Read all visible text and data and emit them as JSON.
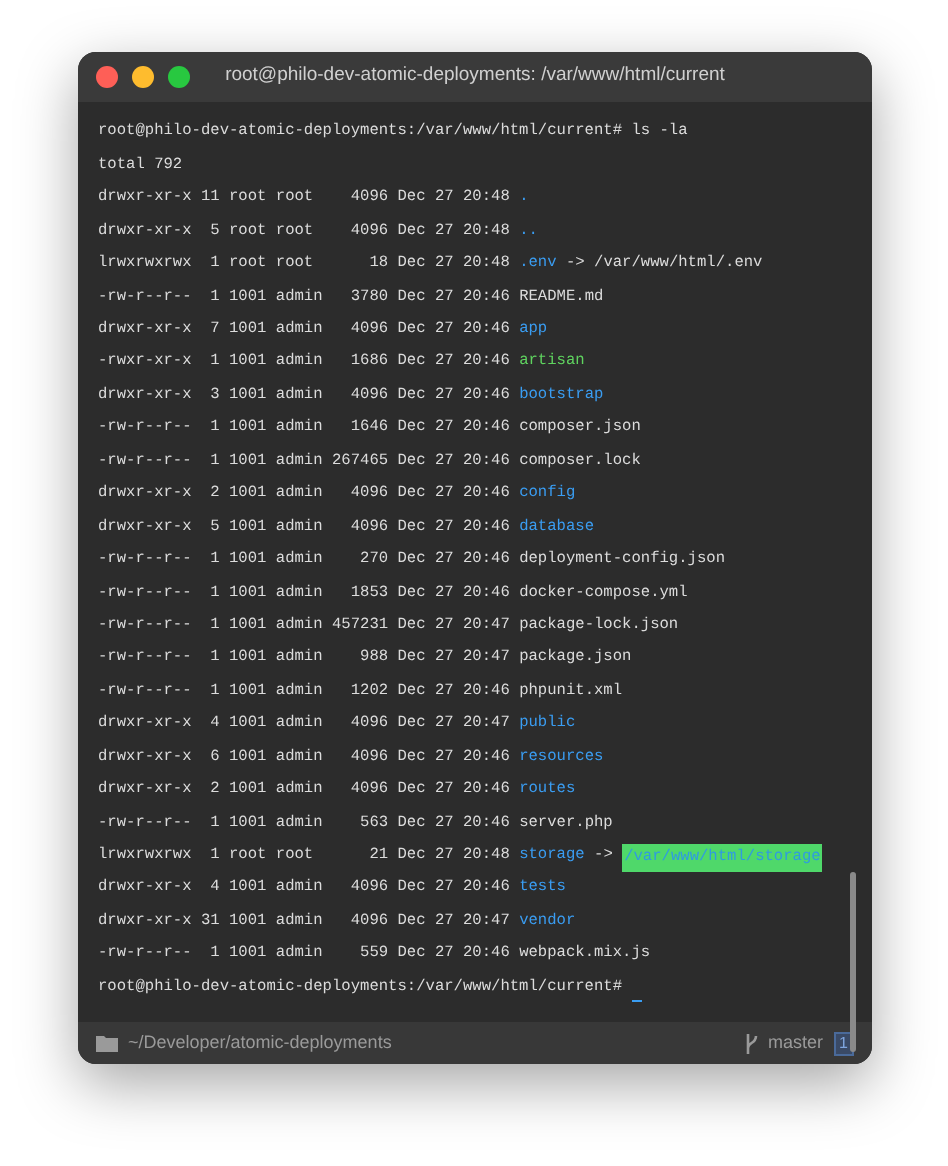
{
  "window": {
    "title": "root@philo-dev-atomic-deployments: /var/www/html/current"
  },
  "terminal": {
    "command_line": "root@philo-dev-atomic-deployments:/var/www/html/current# ls -la",
    "total": "total 792",
    "entries": [
      {
        "info": "drwxr-xr-x 11 root root    4096 Dec 27 20:48",
        "name": ".",
        "kind": "dir"
      },
      {
        "info": "drwxr-xr-x  5 root root    4096 Dec 27 20:48",
        "name": "..",
        "kind": "dir"
      },
      {
        "info": "lrwxrwxrwx  1 root root      18 Dec 27 20:48",
        "name": ".env",
        "kind": "link",
        "arrow": "->",
        "target": "/var/www/html/.env",
        "target_highlighted": false
      },
      {
        "info": "-rw-r--r--  1 1001 admin   3780 Dec 27 20:46",
        "name": "README.md",
        "kind": "file"
      },
      {
        "info": "drwxr-xr-x  7 1001 admin   4096 Dec 27 20:46",
        "name": "app",
        "kind": "dir"
      },
      {
        "info": "-rwxr-xr-x  1 1001 admin   1686 Dec 27 20:46",
        "name": "artisan",
        "kind": "exec"
      },
      {
        "info": "drwxr-xr-x  3 1001 admin   4096 Dec 27 20:46",
        "name": "bootstrap",
        "kind": "dir"
      },
      {
        "info": "-rw-r--r--  1 1001 admin   1646 Dec 27 20:46",
        "name": "composer.json",
        "kind": "file"
      },
      {
        "info": "-rw-r--r--  1 1001 admin 267465 Dec 27 20:46",
        "name": "composer.lock",
        "kind": "file"
      },
      {
        "info": "drwxr-xr-x  2 1001 admin   4096 Dec 27 20:46",
        "name": "config",
        "kind": "dir"
      },
      {
        "info": "drwxr-xr-x  5 1001 admin   4096 Dec 27 20:46",
        "name": "database",
        "kind": "dir"
      },
      {
        "info": "-rw-r--r--  1 1001 admin    270 Dec 27 20:46",
        "name": "deployment-config.json",
        "kind": "file"
      },
      {
        "info": "-rw-r--r--  1 1001 admin   1853 Dec 27 20:46",
        "name": "docker-compose.yml",
        "kind": "file"
      },
      {
        "info": "-rw-r--r--  1 1001 admin 457231 Dec 27 20:47",
        "name": "package-lock.json",
        "kind": "file"
      },
      {
        "info": "-rw-r--r--  1 1001 admin    988 Dec 27 20:47",
        "name": "package.json",
        "kind": "file"
      },
      {
        "info": "-rw-r--r--  1 1001 admin   1202 Dec 27 20:46",
        "name": "phpunit.xml",
        "kind": "file"
      },
      {
        "info": "drwxr-xr-x  4 1001 admin   4096 Dec 27 20:47",
        "name": "public",
        "kind": "dir"
      },
      {
        "info": "drwxr-xr-x  6 1001 admin   4096 Dec 27 20:46",
        "name": "resources",
        "kind": "dir"
      },
      {
        "info": "drwxr-xr-x  2 1001 admin   4096 Dec 27 20:46",
        "name": "routes",
        "kind": "dir"
      },
      {
        "info": "-rw-r--r--  1 1001 admin    563 Dec 27 20:46",
        "name": "server.php",
        "kind": "file"
      },
      {
        "info": "lrwxrwxrwx  1 root root      21 Dec 27 20:48",
        "name": "storage",
        "kind": "link",
        "arrow": "->",
        "target": "/var/www/html/storage",
        "target_highlighted": true
      },
      {
        "info": "drwxr-xr-x  4 1001 admin   4096 Dec 27 20:46",
        "name": "tests",
        "kind": "dir"
      },
      {
        "info": "drwxr-xr-x 31 1001 admin   4096 Dec 27 20:47",
        "name": "vendor",
        "kind": "dir"
      },
      {
        "info": "-rw-r--r--  1 1001 admin    559 Dec 27 20:46",
        "name": "webpack.mix.js",
        "kind": "file"
      }
    ],
    "prompt": "root@philo-dev-atomic-deployments:/var/www/html/current#"
  },
  "status_bar": {
    "path": "~/Developer/atomic-deployments",
    "branch": "master",
    "badge": "1"
  }
}
